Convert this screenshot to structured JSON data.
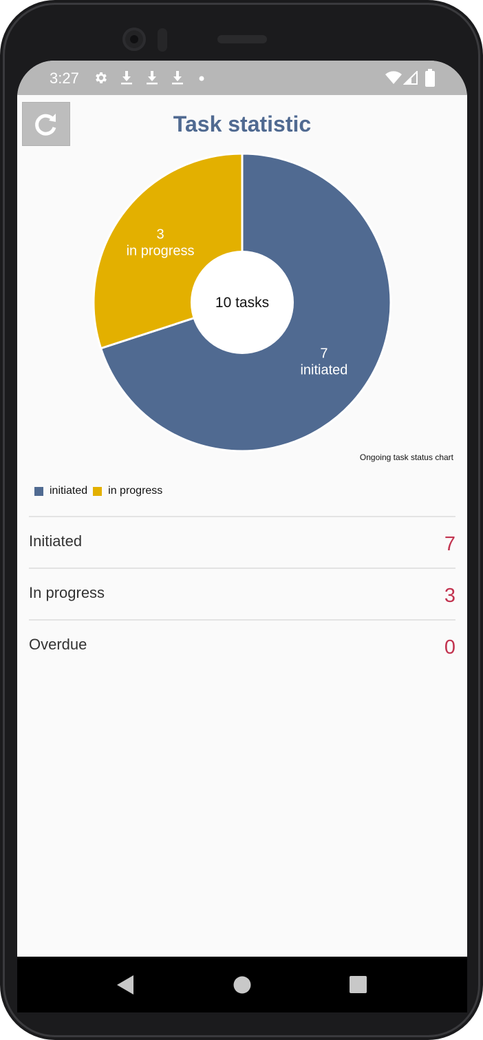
{
  "status_bar": {
    "time": "3:27",
    "icons": [
      "settings-icon",
      "download-icon",
      "download-icon",
      "download-icon",
      "dot-icon",
      "wifi-icon",
      "signal-icon",
      "battery-icon"
    ]
  },
  "header": {
    "title": "Task statistic",
    "refresh_icon": "refresh-icon"
  },
  "chart": {
    "center_label": "10 tasks",
    "caption": "Ongoing task status chart"
  },
  "chart_data": {
    "type": "pie",
    "categories": [
      "initiated",
      "in progress"
    ],
    "values": [
      7,
      3
    ],
    "colors": [
      "#506a91",
      "#e3b000"
    ],
    "slice_labels": [
      {
        "value": "7",
        "name": "initiated"
      },
      {
        "value": "3",
        "name": "in progress"
      }
    ],
    "total_label": "10 tasks",
    "caption": "Ongoing task status chart",
    "legend": [
      "initiated",
      "in progress"
    ],
    "legend_position": "bottom-left"
  },
  "stats": [
    {
      "label": "Initiated",
      "value": "7"
    },
    {
      "label": "In progress",
      "value": "3"
    },
    {
      "label": "Overdue",
      "value": "0"
    }
  ],
  "colors": {
    "accent": "#506a91",
    "initiated": "#506a91",
    "in_progress": "#e3b000",
    "stat_value": "#c2334f"
  },
  "nav": {
    "back_icon": "back-icon",
    "home_icon": "home-icon",
    "recents_icon": "recents-icon"
  }
}
